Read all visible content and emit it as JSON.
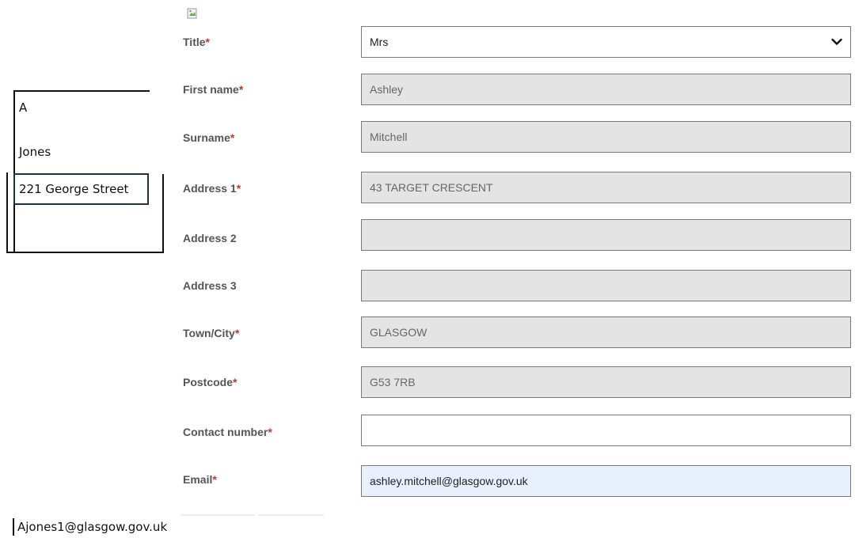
{
  "form": {
    "title": {
      "label": "Title",
      "required": "*",
      "value": "Mrs"
    },
    "first_name": {
      "label": "First name",
      "required": "*",
      "value": "Ashley"
    },
    "surname": {
      "label": "Surname",
      "required": "*",
      "value": "Mitchell"
    },
    "address1": {
      "label": "Address 1",
      "required": "*",
      "value": "43 TARGET CRESCENT"
    },
    "address2": {
      "label": "Address 2",
      "value": ""
    },
    "address3": {
      "label": "Address 3",
      "value": ""
    },
    "town": {
      "label": "Town/City",
      "required": "*",
      "value": "GLASGOW"
    },
    "postcode": {
      "label": "Postcode",
      "required": "*",
      "value": "G53 7RB"
    },
    "contact": {
      "label": "Contact number",
      "required": "*",
      "value": ""
    },
    "email": {
      "label": "Email",
      "required": "*",
      "value": "ashley.mitchell@glasgow.gov.uk"
    }
  },
  "notes": {
    "initial": "A",
    "surname": "Jones",
    "street": "221 George Street",
    "email": "Ajones1@glasgow.gov.uk"
  },
  "colors": {
    "required": "#c0392b",
    "disabled_field": "#e4e4e4",
    "autofill_field": "#e8f0fe"
  }
}
